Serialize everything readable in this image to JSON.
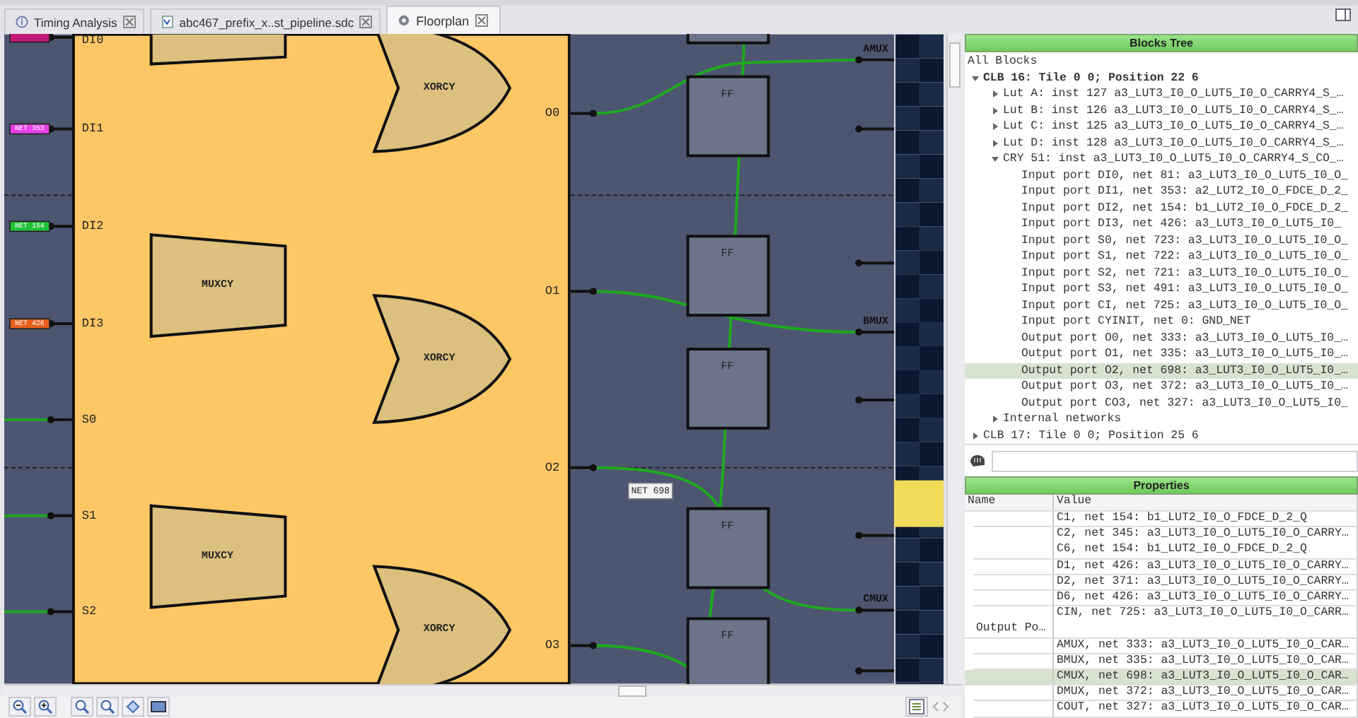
{
  "tabs": [
    {
      "label": "Timing Analysis",
      "kind": "info",
      "selected": false
    },
    {
      "label": "abc467_prefix_x..st_pipeline.sdc",
      "kind": "file",
      "selected": false
    },
    {
      "label": "Floorplan",
      "kind": "gear",
      "selected": true
    }
  ],
  "floorplan": {
    "input_pins": [
      {
        "label": "DI0",
        "net": {
          "color": "#c2187a"
        },
        "wired": false
      },
      {
        "label": "DI1",
        "net": {
          "text": "NET 353",
          "color": "#e83ee8"
        },
        "wired": false
      },
      {
        "label": "DI2",
        "net": {
          "text": "NET 154",
          "color": "#22c03a"
        },
        "wired": false
      },
      {
        "label": "DI3",
        "net": {
          "text": "NET 426",
          "color": "#e8601c"
        },
        "wired": false
      },
      {
        "label": "S0",
        "wired": true
      },
      {
        "label": "S1",
        "wired": true
      },
      {
        "label": "S2",
        "wired": true
      }
    ],
    "muxes": [
      "MUXCY",
      "MUXCY"
    ],
    "xors": [
      "XORCY",
      "XORCY",
      "XORCY"
    ],
    "outputs": [
      "O0",
      "O1",
      "O2",
      "O3"
    ],
    "flip_flops": [
      "FF",
      "FF",
      "FF",
      "FF",
      "FF"
    ],
    "mux_outputs": [
      "AMUX",
      "BMUX",
      "CMUX"
    ],
    "tooltip": "NET 698"
  },
  "blocks_tree": {
    "title": "Blocks Tree",
    "root": "All Blocks",
    "items": [
      {
        "label": "CLB 16: Tile 0 0; Position 22 6",
        "bold": true,
        "expanded": true,
        "selected": false,
        "children": [
          {
            "label": "Lut A: inst 127 a3_LUT3_I0_O_LUT5_I0_O_CARRY4_S_…",
            "expanded": false,
            "selected": false
          },
          {
            "label": "Lut B: inst 126 a3_LUT3_I0_O_LUT5_I0_O_CARRY4_S_…",
            "expanded": false,
            "selected": false
          },
          {
            "label": "Lut C: inst 125 a3_LUT3_I0_O_LUT5_I0_O_CARRY4_S_…",
            "expanded": false,
            "selected": false
          },
          {
            "label": "Lut D: inst 128 a3_LUT3_I0_O_LUT5_I0_O_CARRY4_S_…",
            "expanded": false,
            "selected": false
          },
          {
            "label": "CRY 51: inst a3_LUT3_I0_O_LUT5_I0_O_CARRY4_S_CO_…",
            "expanded": true,
            "selected": false,
            "children": [
              {
                "label": "Input port DI0, net 81: a3_LUT3_I0_O_LUT5_I0_O_",
                "selected": false
              },
              {
                "label": "Input port DI1, net 353: a2_LUT2_I0_O_FDCE_D_2_",
                "selected": false
              },
              {
                "label": "Input port DI2, net 154: b1_LUT2_I0_O_FDCE_D_2_",
                "selected": false
              },
              {
                "label": "Input port DI3, net 426: a3_LUT3_I0_O_LUT5_I0_",
                "selected": false
              },
              {
                "label": "Input port S0, net 723: a3_LUT3_I0_O_LUT5_I0_O_",
                "selected": false
              },
              {
                "label": "Input port S1, net 722: a3_LUT3_I0_O_LUT5_I0_O_",
                "selected": false
              },
              {
                "label": "Input port S2, net 721: a3_LUT3_I0_O_LUT5_I0_O_",
                "selected": false
              },
              {
                "label": "Input port S3, net 491: a3_LUT3_I0_O_LUT5_I0_O_",
                "selected": false
              },
              {
                "label": "Input port CI, net 725: a3_LUT3_I0_O_LUT5_I0_O_",
                "selected": false
              },
              {
                "label": "Input port CYINIT, net 0: GND_NET",
                "selected": false
              },
              {
                "label": "Output port O0, net 333: a3_LUT3_I0_O_LUT5_I0_…",
                "selected": false
              },
              {
                "label": "Output port O1, net 335: a3_LUT3_I0_O_LUT5_I0_…",
                "selected": false
              },
              {
                "label": "Output port O2, net 698: a3_LUT3_I0_O_LUT5_I0_…",
                "selected": true
              },
              {
                "label": "Output port O3, net 372: a3_LUT3_I0_O_LUT5_I0_…",
                "selected": false
              },
              {
                "label": "Output port CO3, net 327: a3_LUT3_I0_O_LUT5_I0_",
                "selected": false
              }
            ]
          },
          {
            "label": "Internal networks",
            "expanded": false,
            "selected": false
          }
        ]
      },
      {
        "label": "CLB 17: Tile 0 0; Position 25 6",
        "bold": false,
        "expanded": false,
        "selected": false
      }
    ]
  },
  "properties": {
    "title": "Properties",
    "columns": [
      "Name",
      "Value"
    ],
    "rows": [
      {
        "value": "C1, net 154: b1_LUT2_I0_O_FDCE_D_2_Q",
        "selected": false
      },
      {
        "value": "C2, net 345: a3_LUT3_I0_O_LUT5_I0_O_CARRY…",
        "selected": false
      },
      {
        "value": "C6, net 154: b1_LUT2_I0_O_FDCE_D_2_Q",
        "selected": false
      },
      {
        "value": "D1, net 426: a3_LUT3_I0_O_LUT5_I0_O_CARRY…",
        "selected": false
      },
      {
        "value": "D2, net 371: a3_LUT3_I0_O_LUT5_I0_O_CARRY…",
        "selected": false
      },
      {
        "value": "D6, net 426: a3_LUT3_I0_O_LUT5_I0_O_CARRY…",
        "selected": false
      },
      {
        "value": "CIN, net 725: a3_LUT3_I0_O_LUT5_I0_O_CARR…",
        "selected": false
      },
      {
        "name": "Output Po…",
        "selected": false
      },
      {
        "value": "AMUX, net 333: a3_LUT3_I0_O_LUT5_I0_O_CAR…",
        "selected": false
      },
      {
        "value": "BMUX, net 335: a3_LUT3_I0_O_LUT5_I0_O_CAR…",
        "selected": false
      },
      {
        "value": "CMUX, net 698: a3_LUT3_I0_O_LUT5_I0_O_CAR…",
        "selected": true
      },
      {
        "value": "DMUX, net 372: a3_LUT3_I0_O_LUT5_I0_O_CAR…",
        "selected": false
      },
      {
        "value": "COUT, net 327: a3_LUT3_I0_O_LUT5_I0_O_CAR…",
        "selected": false
      }
    ]
  }
}
